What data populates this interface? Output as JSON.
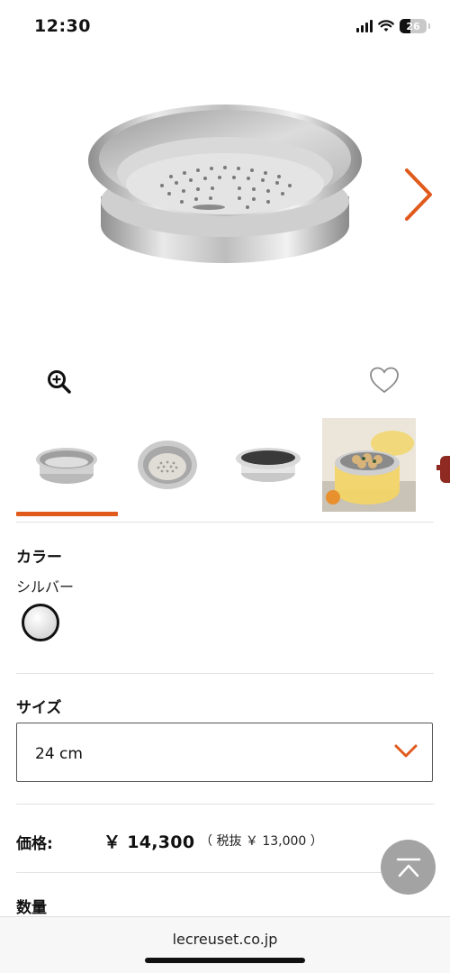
{
  "status_bar": {
    "time": "12:30",
    "battery_level": "26",
    "icons": [
      "signal-icon",
      "wifi-icon",
      "battery-icon"
    ]
  },
  "product": {
    "image_count_visible": 5
  },
  "thumbnails": [
    {
      "name": "steamer-front"
    },
    {
      "name": "steamer-top"
    },
    {
      "name": "steamer-side"
    },
    {
      "name": "steamer-in-use"
    },
    {
      "name": "red-pot-partial"
    }
  ],
  "color": {
    "label": "カラー",
    "value": "シルバー"
  },
  "size": {
    "label": "サイズ",
    "value": "24 cm"
  },
  "price": {
    "label": "価格:",
    "value": "￥ 14,300",
    "tax_excluded": "（ 税抜 ￥ 13,000 ）"
  },
  "quantity": {
    "label": "数量"
  },
  "browser": {
    "url": "lecreuset.co.jp"
  },
  "colors": {
    "accent": "#e05a1c",
    "back_to_top_bg": "#a3a3a3"
  }
}
